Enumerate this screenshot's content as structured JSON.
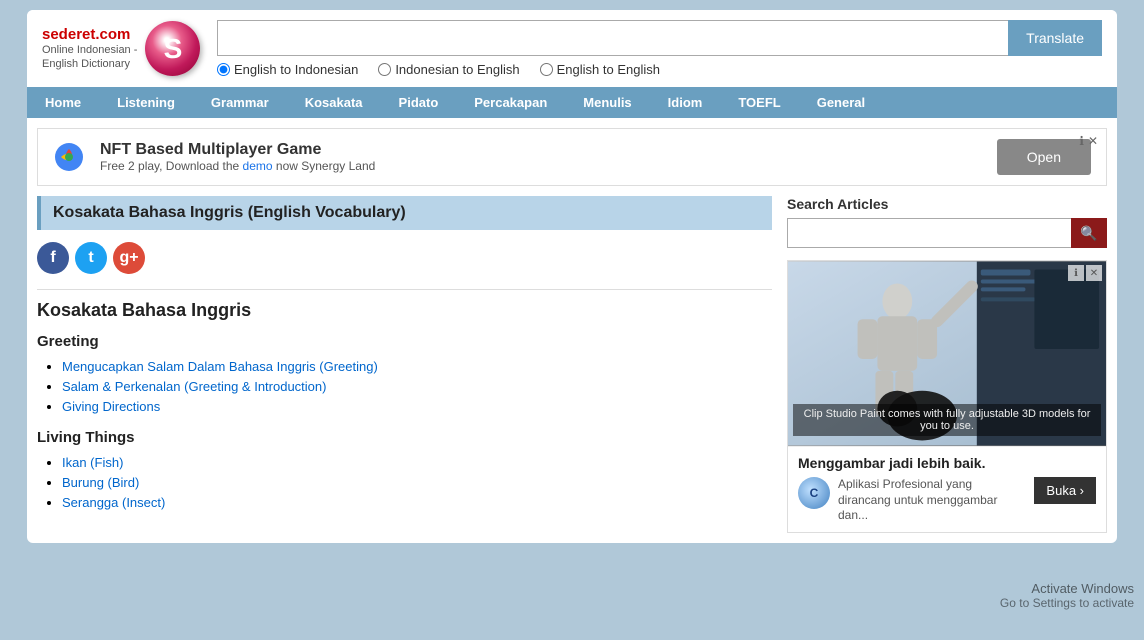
{
  "site": {
    "name": "sederet.com",
    "tagline": "Online Indonesian -",
    "tagline2": "English Dictionary",
    "logo_letter": "S"
  },
  "header": {
    "search_placeholder": "",
    "translate_label": "Translate",
    "radio_options": [
      {
        "id": "r1",
        "label": "English to Indonesian",
        "checked": true
      },
      {
        "id": "r2",
        "label": "Indonesian to English",
        "checked": false
      },
      {
        "id": "r3",
        "label": "English to English",
        "checked": false
      }
    ]
  },
  "nav": {
    "items": [
      {
        "label": "Home"
      },
      {
        "label": "Listening"
      },
      {
        "label": "Grammar"
      },
      {
        "label": "Kosakata"
      },
      {
        "label": "Pidato"
      },
      {
        "label": "Percakapan"
      },
      {
        "label": "Menulis"
      },
      {
        "label": "Idiom"
      },
      {
        "label": "TOEFL"
      },
      {
        "label": "General"
      }
    ]
  },
  "ad_banner": {
    "title": "NFT Based Multiplayer Game",
    "subtitle": "Free 2 play, Download the demo now Synergy Land",
    "open_label": "Open",
    "demo_link": "demo"
  },
  "main": {
    "page_title": "Kosakata Bahasa Inggris (English Vocabulary)",
    "section_title": "Kosakata Bahasa Inggris",
    "categories": [
      {
        "title": "Greeting",
        "links": [
          "Mengucapkan Salam Dalam Bahasa Inggris (Greeting)",
          "Salam & Perkenalan (Greeting & Introduction)",
          "Giving Directions"
        ]
      },
      {
        "title": "Living Things",
        "links": [
          "Ikan (Fish)",
          "Burung (Bird)",
          "Serangga (Insect)"
        ]
      }
    ]
  },
  "sidebar": {
    "search_articles_title": "Search Articles",
    "search_placeholder": "",
    "ad": {
      "caption": "Clip Studio Paint comes with\nfully adjustable 3D models for you to use.",
      "main_title": "Menggambar jadi lebih baik.",
      "desc": "Aplikasi Profesional yang dirancang untuk menggambar dan...",
      "cta_label": "Buka ›"
    }
  },
  "activate_windows": {
    "line1": "Activate Windows",
    "line2": "Go to Settings to activate"
  }
}
